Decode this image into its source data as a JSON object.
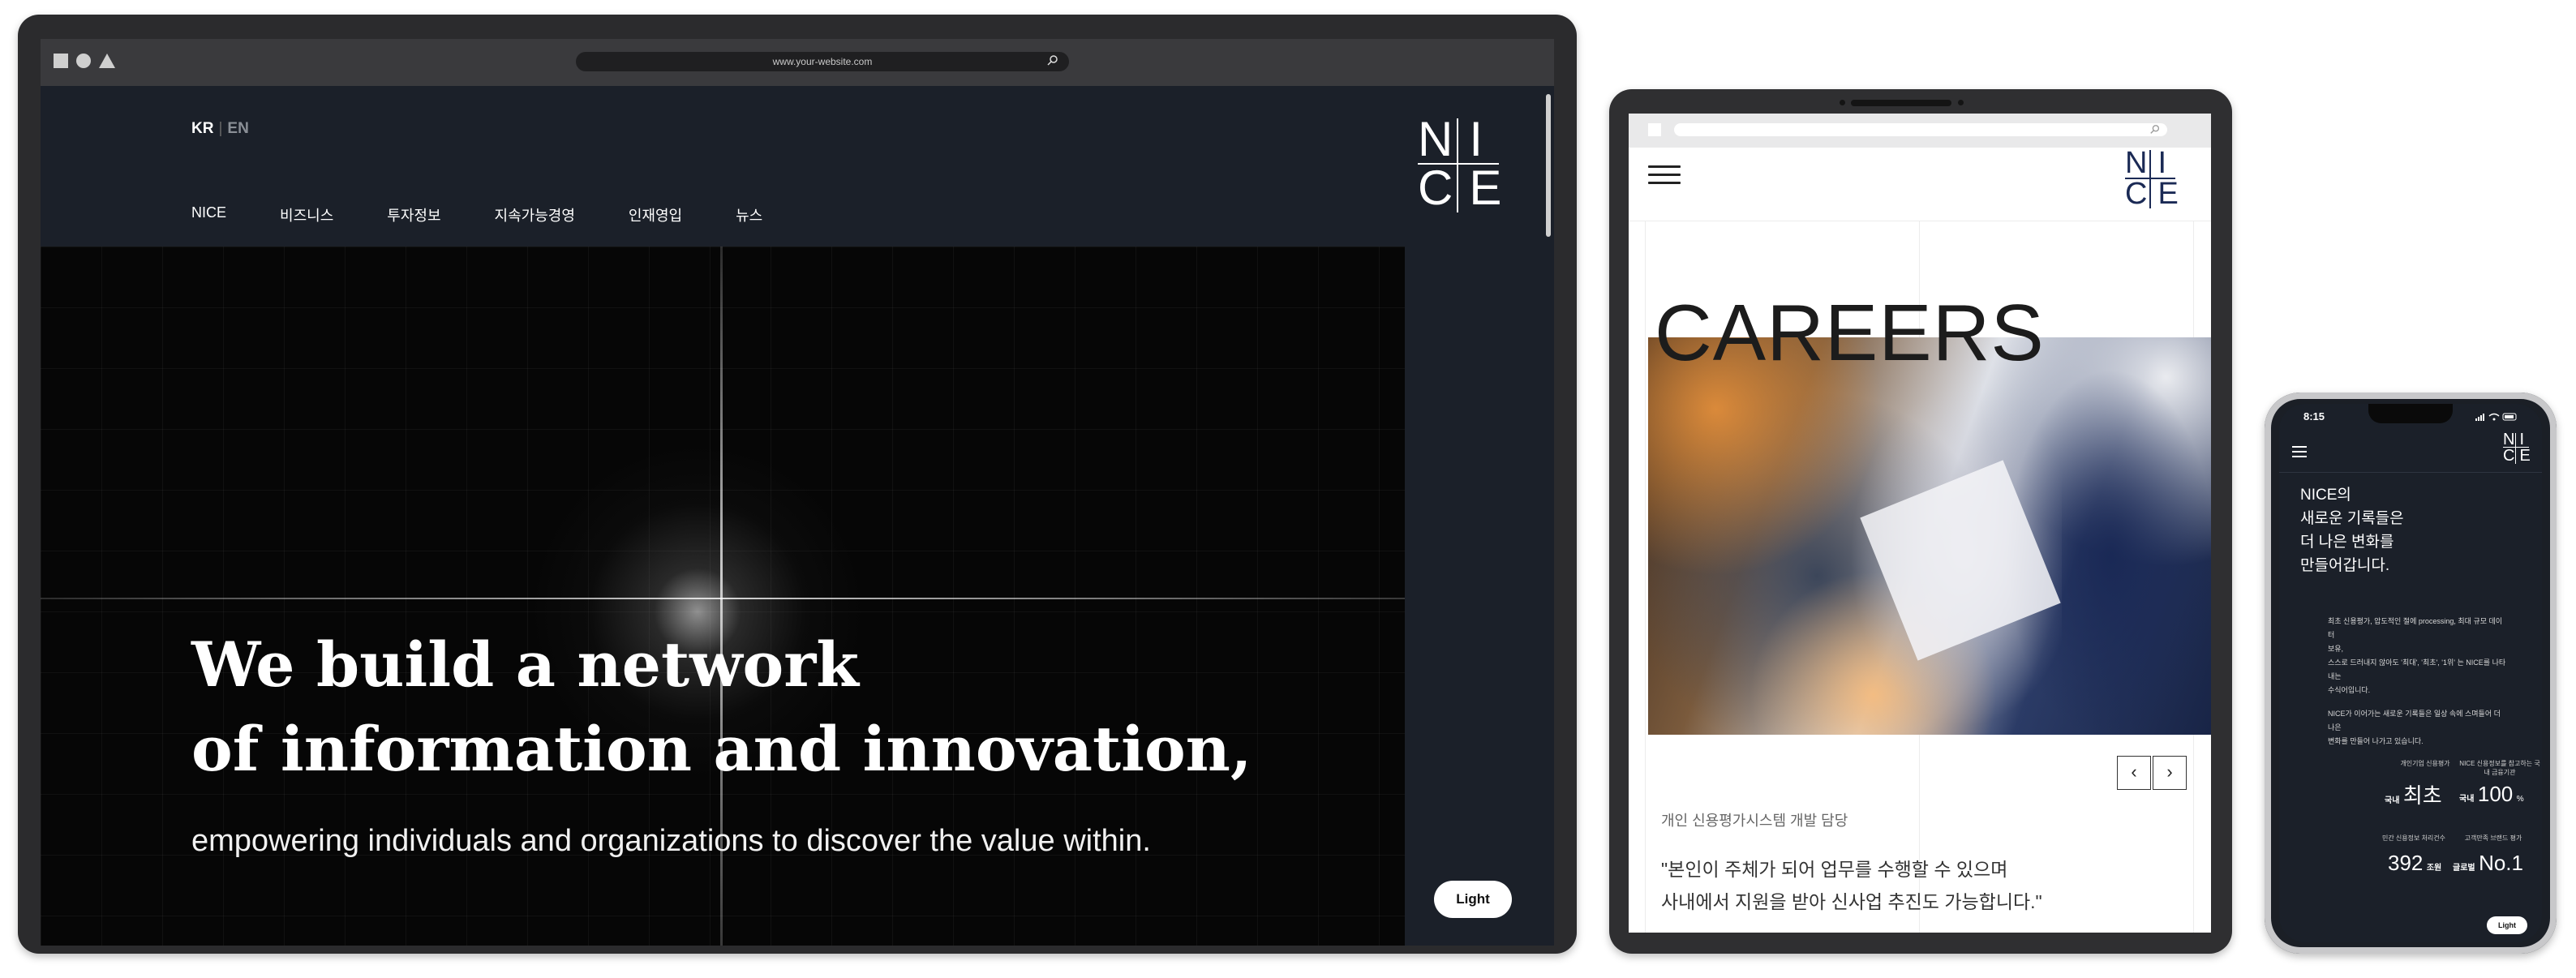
{
  "laptop": {
    "url": "www.your-website.com",
    "lang": {
      "kr": "KR",
      "en": "EN"
    },
    "nav": [
      "NICE",
      "비즈니스",
      "투자정보",
      "지속가능경영",
      "인재영입",
      "뉴스"
    ],
    "logo": {
      "top": "NI",
      "bottom": "CE"
    },
    "hero": {
      "line1": "We build a network",
      "line2": "of information and innovation,",
      "sub": "empowering individuals and organizations to discover the value within."
    },
    "light_label": "Light"
  },
  "tablet": {
    "logo": {
      "top": "NI",
      "bottom": "CE"
    },
    "heading": "CAREERS",
    "prev": "‹",
    "next": "›",
    "role": "개인 신용평가시스템 개발 담당",
    "quote_line1": "\"본인이 주체가 되어 업무를 수행할 수 있으며",
    "quote_line2": "사내에서 지원을 받아 신사업 추진도 가능합니다.\""
  },
  "phone": {
    "time": "8:15",
    "logo": {
      "top": "NI",
      "bottom": "CE"
    },
    "headline": [
      "NICE의",
      "새로운 기록들은",
      "더 나은 변화를",
      "만들어갑니다."
    ],
    "para1": [
      "최초 신용평가, 압도적인 절에 processing, 최대 규모 데이터",
      "보유,",
      "스스로 드러내지 않아도 '최대', '최초', '1위' 는 NICE를 나타내는",
      "수식어입니다."
    ],
    "para2": [
      "NICE가 이어가는 새로운 기록들은 일상 속에 스며들어 더 나은",
      "변화를 만들어 나가고 있습니다."
    ],
    "stats": [
      {
        "label": "개인기업 신용평가",
        "prefix": "국내",
        "value": "최초",
        "suffix": ""
      },
      {
        "label": "NICE 신용정보를 참고하는 국내 금융기관",
        "prefix": "국내",
        "value": "100",
        "suffix": "%"
      },
      {
        "label": "민간 신용정보 처리건수",
        "prefix": "",
        "value": "392",
        "suffix": "조원"
      },
      {
        "label": "고객만족 브랜드 평가",
        "prefix": "글로벌",
        "value": "No.1",
        "suffix": ""
      }
    ],
    "light_label": "Light"
  }
}
